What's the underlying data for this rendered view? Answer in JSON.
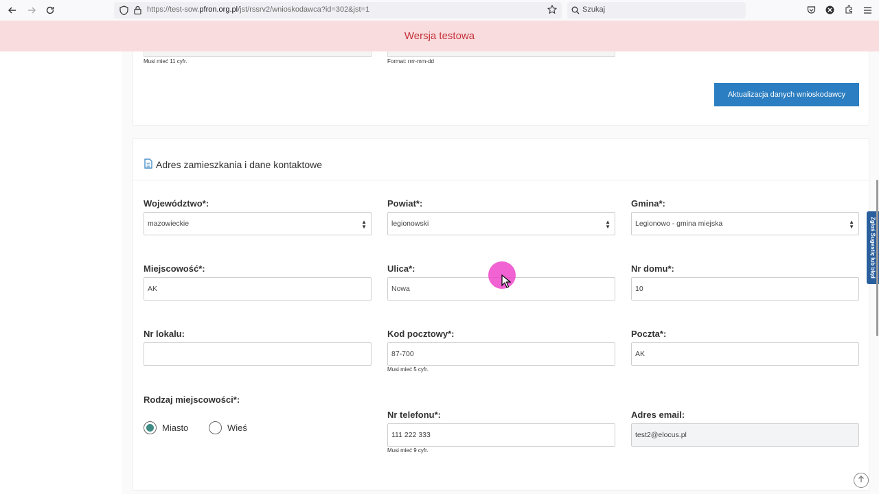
{
  "browser": {
    "url_prefix": "https://test-sow.",
    "url_domain": "pfron.org.pl",
    "url_path": "/jst/rssrv2/wnioskodawca?id=302&jst=1",
    "search_placeholder": "Szukaj"
  },
  "banner": {
    "text": "Wersja testowa"
  },
  "top_card": {
    "hint_left": "Musi mieć 11 cyfr.",
    "hint_right": "Format: rrrr-mm-dd",
    "update_button": "Aktualizacja danych wnioskodawcy"
  },
  "address_section": {
    "title": "Adres zamieszkania i dane kontaktowe",
    "wojewodztwo": {
      "label": "Województwo*:",
      "value": "mazowieckie"
    },
    "powiat": {
      "label": "Powiat*:",
      "value": "legionowski"
    },
    "gmina": {
      "label": "Gmina*:",
      "value": "Legionowo - gmina miejska"
    },
    "miejscowosc": {
      "label": "Miejscowość*:",
      "value": "AK"
    },
    "ulica": {
      "label": "Ulica*:",
      "value": "Nowa"
    },
    "nr_domu": {
      "label": "Nr domu*:",
      "value": "10"
    },
    "nr_lokalu": {
      "label": "Nr lokalu:",
      "value": ""
    },
    "kod_pocztowy": {
      "label": "Kod pocztowy*:",
      "value": "87-700",
      "hint": "Musi mieć 5 cyfr."
    },
    "poczta": {
      "label": "Poczta*:",
      "value": "AK"
    },
    "rodzaj": {
      "label": "Rodzaj miejscowości*:",
      "options": [
        "Miasto",
        "Wieś"
      ],
      "selected": "Miasto"
    },
    "telefon": {
      "label": "Nr telefonu*:",
      "value": "111 222 333",
      "hint": "Musi mieć 9 cyfr."
    },
    "email": {
      "label": "Adres email:",
      "value": "test2@elocus.pl"
    }
  },
  "side_tab": {
    "text": "Zgłoś Sugestię lub błąd"
  },
  "colors": {
    "primary": "#2b7ec1",
    "banner_bg": "#f9dcdd",
    "banner_text": "#c4313a",
    "radio_on": "#3d8b84",
    "side_tab": "#2a5f9e"
  }
}
